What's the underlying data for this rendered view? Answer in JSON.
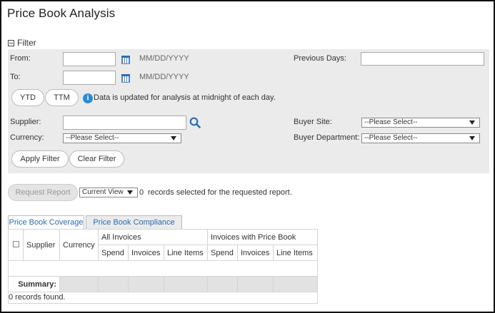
{
  "page": {
    "title": "Price Book Analysis"
  },
  "filter": {
    "header": "Filter",
    "from_label": "From:",
    "to_label": "To:",
    "date_format_from": "MM/DD/YYYY",
    "date_format_to": "MM/DD/YYYY",
    "from_value": "",
    "to_value": "",
    "previous_days_label": "Previous Days:",
    "previous_days_value": "",
    "ytd_label": "YTD",
    "ttm_label": "TTM",
    "info_text": "Data is updated for analysis at midnight of each day.",
    "supplier_label": "Supplier:",
    "supplier_value": "",
    "currency_label": "Currency:",
    "currency_selected": "--Please Select--",
    "buyer_site_label": "Buyer Site:",
    "buyer_site_selected": "--Please Select--",
    "buyer_department_label": "Buyer Department:",
    "buyer_department_selected": "--Please Select--",
    "apply_label": "Apply Filter",
    "clear_label": "Clear Filter"
  },
  "report": {
    "request_label": "Request Report",
    "view_selected": "Current View",
    "selected_count": "0",
    "selected_text": "records selected for the requested report."
  },
  "tabs": [
    {
      "label": "Price Book Coverage",
      "active": true
    },
    {
      "label": "Price Book Compliance",
      "active": false
    }
  ],
  "table": {
    "col_supplier": "Supplier",
    "col_currency": "Currency",
    "group_all": "All Invoices",
    "group_pb": "Invoices with Price Book",
    "sub_spend": "Spend",
    "sub_invoices": "Invoices",
    "sub_line_items": "Line Items",
    "summary_label": "Summary:",
    "footer": "0 records found."
  },
  "colors": {
    "accent": "#2a6db3",
    "info": "#2b8bd6",
    "panel": "#ebebeb"
  }
}
